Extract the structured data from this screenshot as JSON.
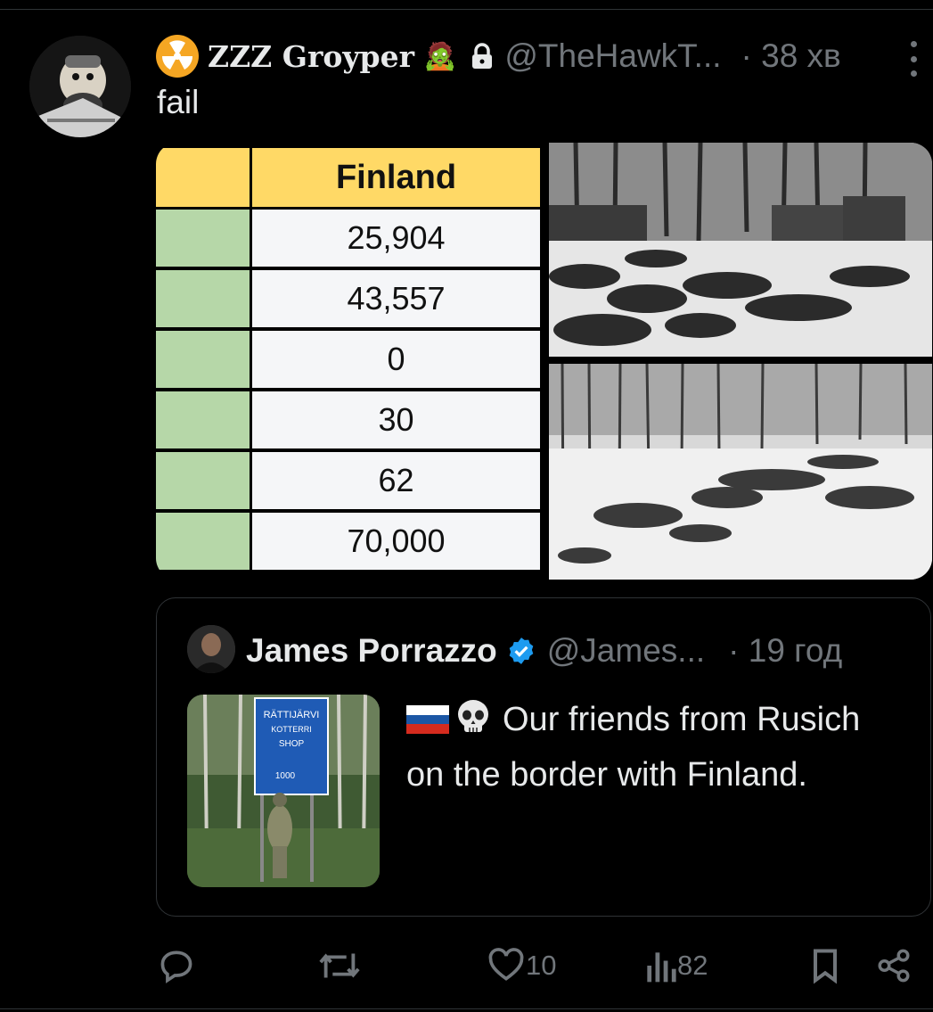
{
  "post": {
    "author_name": "ZZZ Groyper",
    "author_handle": "@TheHawkT...",
    "time": "· 38 хв",
    "text": "fail",
    "icons": [
      "radiation-icon",
      "zombie-emoji",
      "lock-icon",
      "more-icon"
    ]
  },
  "table": {
    "header": "Finland",
    "rows": [
      "25,904",
      "43,557",
      "0",
      "30",
      "62",
      "70,000"
    ],
    "colors": {
      "header": "#ffd966",
      "left_column": "#b6d7a8",
      "cells": "#f5f6f8"
    }
  },
  "quote": {
    "author_name": "James Porrazzo",
    "author_handle": "@James...",
    "time": "· 19 год",
    "text": "Our friends from Rusich on the border with Finland.",
    "thumbnail_sign": [
      "RÄTTIJÄRVI",
      "KOTTERRI",
      "SHOP",
      "1000"
    ]
  },
  "actions": {
    "reply_count": "",
    "repost_count": "",
    "like_count": "10",
    "views_count": "82"
  },
  "theme": {
    "background": "#000000",
    "text": "#e7e9ea",
    "muted": "#71767b",
    "border": "#2f3336",
    "verified": "#1d9bf0"
  }
}
